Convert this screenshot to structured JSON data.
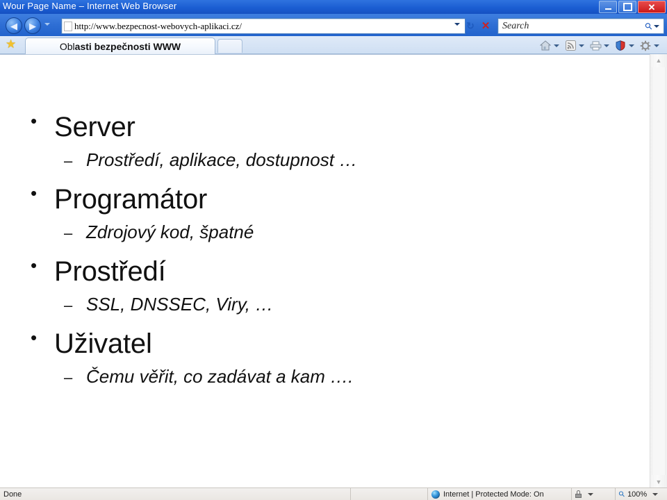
{
  "window": {
    "title": "Wour Page Name – Internet Web Browser",
    "minimize_label": "Minimize",
    "maximize_label": "Restore",
    "close_label": "✕"
  },
  "navigation": {
    "back_glyph": "◀",
    "forward_glyph": "▶",
    "url": "http://www.bezpecnost-webovych-aplikaci.cz/",
    "refresh_glyph": "↻",
    "stop_glyph": "✕",
    "search_placeholder": "Search",
    "search_value": "",
    "search_glyph": "⚲"
  },
  "tabs": {
    "favorites_glyph": "★",
    "items": [
      {
        "label_thin": "Obl",
        "label_bold": "asti bezpečnosti WWW"
      }
    ],
    "new_tab_label": ""
  },
  "toolbar": {
    "items": [
      {
        "name": "home-icon",
        "glyph": "⌂"
      },
      {
        "name": "rss-feed-icon",
        "glyph": "≋"
      },
      {
        "name": "print-icon",
        "glyph": "⎙"
      },
      {
        "name": "safety-shield-icon",
        "glyph": "⛊"
      },
      {
        "name": "tools-gear-icon",
        "glyph": "⚙"
      }
    ]
  },
  "content": {
    "bullet_glyph": "•",
    "dash_glyph": "–",
    "items": [
      {
        "title": "Server",
        "sub": "Prostředí, aplikace, dostupnost …"
      },
      {
        "title": "Programátor",
        "sub": "Zdrojový kod, špatné"
      },
      {
        "title": "Prostředí",
        "sub": "SSL, DNSSEC, Viry, …"
      },
      {
        "title": "Uživatel",
        "sub": "Čemu věřit, co zadávat a kam …."
      }
    ]
  },
  "scrollbar": {
    "up_glyph": "▲",
    "down_glyph": "▼"
  },
  "statusbar": {
    "status": "Done",
    "zone": "Internet | Protected Mode: On",
    "zoom": "100%"
  },
  "colors": {
    "title_bar": "#1b5ed2",
    "nav_bar": "#2e6ed4",
    "tab_bar": "#dfeaf8",
    "close_button": "#cb1a1a",
    "favorites_star": "#f2c12e",
    "status_bar": "#eae7e3",
    "page_background": "#ffffff",
    "text": "#111111"
  }
}
